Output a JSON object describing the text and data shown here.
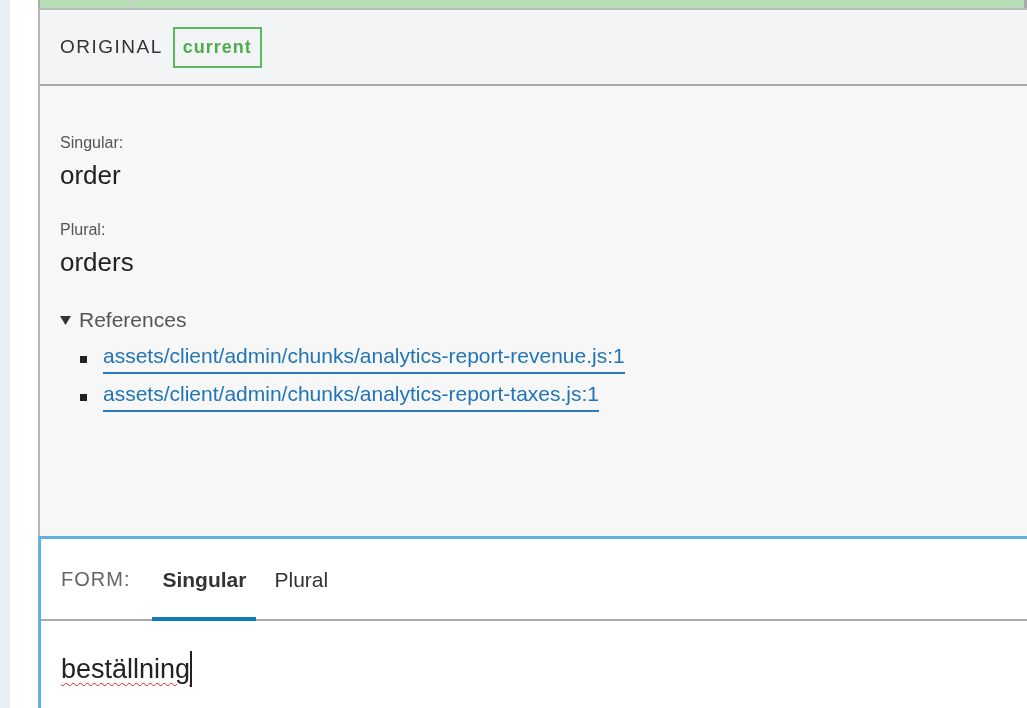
{
  "header": {
    "title": "ORIGINAL",
    "badge": "current"
  },
  "fields": [
    {
      "label": "Singular:",
      "value": "order"
    },
    {
      "label": "Plural:",
      "value": "orders"
    }
  ],
  "references": {
    "label": "References",
    "expanded": true,
    "links": [
      "assets/client/admin/chunks/analytics-report-revenue.js:1",
      "assets/client/admin/chunks/analytics-report-taxes.js:1"
    ]
  },
  "form": {
    "label": "FORM:",
    "tabs": [
      {
        "label": "Singular",
        "selected": true
      },
      {
        "label": "Plural",
        "selected": false
      }
    ],
    "value": "beställning",
    "misspelled": true
  }
}
